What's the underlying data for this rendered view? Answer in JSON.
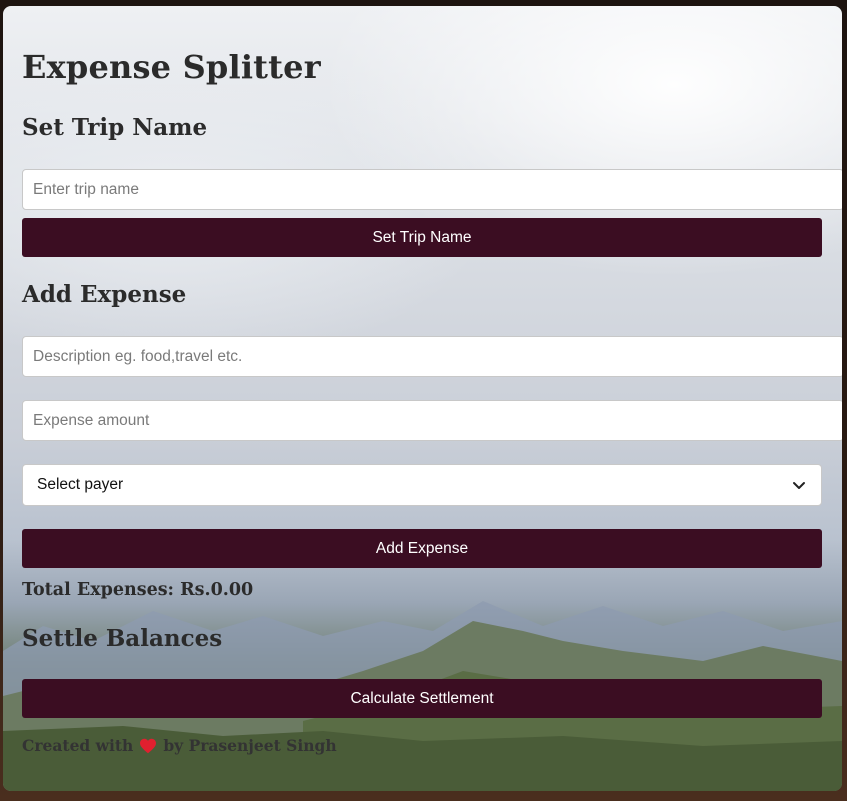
{
  "app": {
    "title": "Expense Splitter"
  },
  "trip": {
    "heading": "Set Trip Name",
    "input_placeholder": "Enter trip name",
    "button_label": "Set Trip Name"
  },
  "expense": {
    "heading": "Add Expense",
    "description_placeholder": "Description eg. food,travel etc.",
    "amount_placeholder": "Expense amount",
    "payer_selected": "Select payer",
    "button_label": "Add Expense",
    "total_text": "Total Expenses: Rs.0.00"
  },
  "settle": {
    "heading": "Settle Balances",
    "button_label": "Calculate Settlement"
  },
  "footer": {
    "prefix": "Created with",
    "icon": "heart-icon",
    "suffix": "by Prasenjeet Singh"
  },
  "colors": {
    "button_bg": "#3b0d22",
    "heart": "#e0202f"
  }
}
